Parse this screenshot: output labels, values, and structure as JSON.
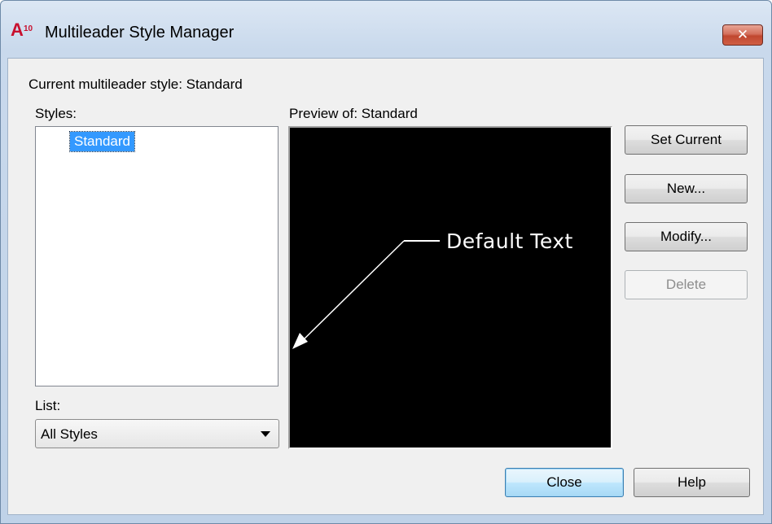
{
  "window": {
    "title": "Multileader Style Manager",
    "icon_text": "A",
    "icon_version": "10",
    "close_glyph": "✕"
  },
  "current_style": {
    "label": "Current multileader style: Standard"
  },
  "styles": {
    "label": "Styles:",
    "items": [
      "Standard"
    ]
  },
  "list": {
    "label": "List:",
    "selected": "All Styles"
  },
  "preview": {
    "label": "Preview of: Standard",
    "sample_text": "Default Text"
  },
  "buttons": {
    "set_current": "Set Current",
    "new": "New...",
    "modify": "Modify...",
    "delete": "Delete",
    "close": "Close",
    "help": "Help"
  },
  "colors": {
    "selection": "#3399ff",
    "preview_background": "#000000"
  }
}
